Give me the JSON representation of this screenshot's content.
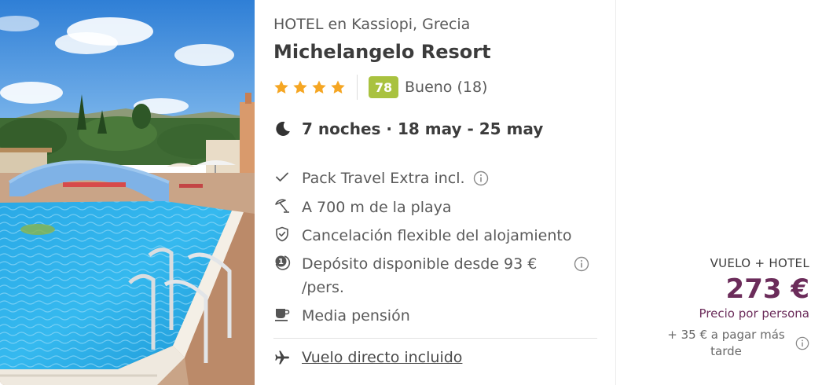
{
  "photo": {
    "icon": "hotel-pool-photo"
  },
  "hotel": {
    "type_line": "HOTEL en Kassiopi, Grecia",
    "name": "Michelangelo Resort",
    "stars": 4,
    "score": "78",
    "score_text": "Bueno (18)"
  },
  "stay": {
    "icon": "moon-icon",
    "text": "7 noches · 18 may - 25 may"
  },
  "features": [
    {
      "icon": "check-icon",
      "text": "Pack Travel Extra incl.",
      "info": true
    },
    {
      "icon": "beach-umbrella-icon",
      "text": "A 700 m de la playa",
      "info": false
    },
    {
      "icon": "shield-check-icon",
      "text": "Cancelación flexible del alojamiento",
      "info": false
    },
    {
      "icon": "deposit-icon",
      "text_line1": "Depósito disponible desde 93 €",
      "text_line2": "/pers.",
      "info": true
    },
    {
      "icon": "cup-icon",
      "text": "Media pensión",
      "info": false
    }
  ],
  "flight": {
    "icon": "plane-icon",
    "text": "Vuelo directo incluido"
  },
  "price": {
    "type": "VUELO + HOTEL",
    "value": "273 €",
    "per_person": "Precio por persona",
    "later_line1": "+ 35 € a pagar más",
    "later_line2": "tarde"
  },
  "colors": {
    "star": "#f5a623",
    "score_bg": "#a9c23f",
    "price": "#6b2c5a"
  }
}
